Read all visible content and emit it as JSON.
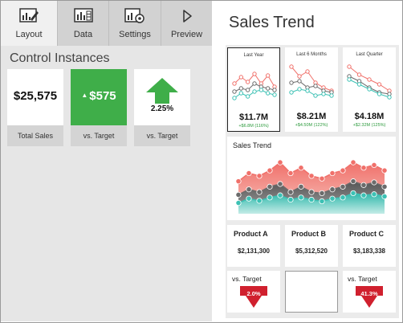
{
  "tabs": [
    {
      "label": "Layout",
      "icon": "layout-icon",
      "active": true
    },
    {
      "label": "Data",
      "icon": "data-icon",
      "active": false
    },
    {
      "label": "Settings",
      "icon": "settings-icon",
      "active": false
    },
    {
      "label": "Preview",
      "icon": "play-icon",
      "active": false
    }
  ],
  "control_instances": {
    "title": "Control Instances",
    "tiles": [
      {
        "value": "$25,575",
        "caption": "Total Sales"
      },
      {
        "value": "$575",
        "caption": "vs. Target",
        "color": "#3fae49"
      },
      {
        "value": "2.25%",
        "caption": "vs. Target",
        "color": "#3fae49"
      }
    ]
  },
  "dashboard": {
    "title": "Sales Trend",
    "mini_cards": [
      {
        "title": "Last Year",
        "value": "$11.7M",
        "sub": "+$6.8M (116%)",
        "selected": true
      },
      {
        "title": "Last 6 Months",
        "value": "$8.21M",
        "sub": "+$4.50M (122%)"
      },
      {
        "title": "Last Quarter",
        "value": "$4.18M",
        "sub": "+$2.32M (125%)"
      }
    ],
    "trend_card_title": "Sales Trend",
    "products": [
      {
        "name": "Product A",
        "value": "$2,131,300"
      },
      {
        "name": "Product B",
        "value": "$5,312,520"
      },
      {
        "name": "Product C",
        "value": "$3,183,338"
      }
    ],
    "vs_target": [
      {
        "label": "vs. Target",
        "value": "2.0%"
      },
      {
        "label": "vs. Target",
        "value": "41.3%"
      }
    ],
    "colors": {
      "red": "#f0706a",
      "dark": "#6b6b6b",
      "teal": "#3cc1b4",
      "green": "#3fae49",
      "down_red": "#d0202e"
    }
  },
  "chart_data": {
    "type": "area",
    "title": "Sales Trend",
    "x": [
      1,
      2,
      3,
      4,
      5,
      6,
      7,
      8,
      9,
      10,
      11,
      12,
      13,
      14,
      15
    ],
    "series": [
      {
        "values": [
          6,
          7.5,
          7,
          8,
          9.5,
          7.5,
          8.5,
          7,
          6.5,
          7.5,
          8,
          9.5,
          8.5,
          9,
          8
        ]
      },
      {
        "values": [
          3.5,
          4.5,
          4,
          5,
          5.5,
          4,
          5,
          4,
          3.8,
          4.5,
          5,
          6,
          5.3,
          5.8,
          5
        ]
      },
      {
        "values": [
          2,
          2.8,
          2.4,
          3,
          3.4,
          2.6,
          3,
          2.6,
          2.3,
          2.8,
          3,
          3.8,
          3.4,
          3.6,
          3.2
        ]
      }
    ],
    "ylim": [
      0,
      11
    ]
  }
}
